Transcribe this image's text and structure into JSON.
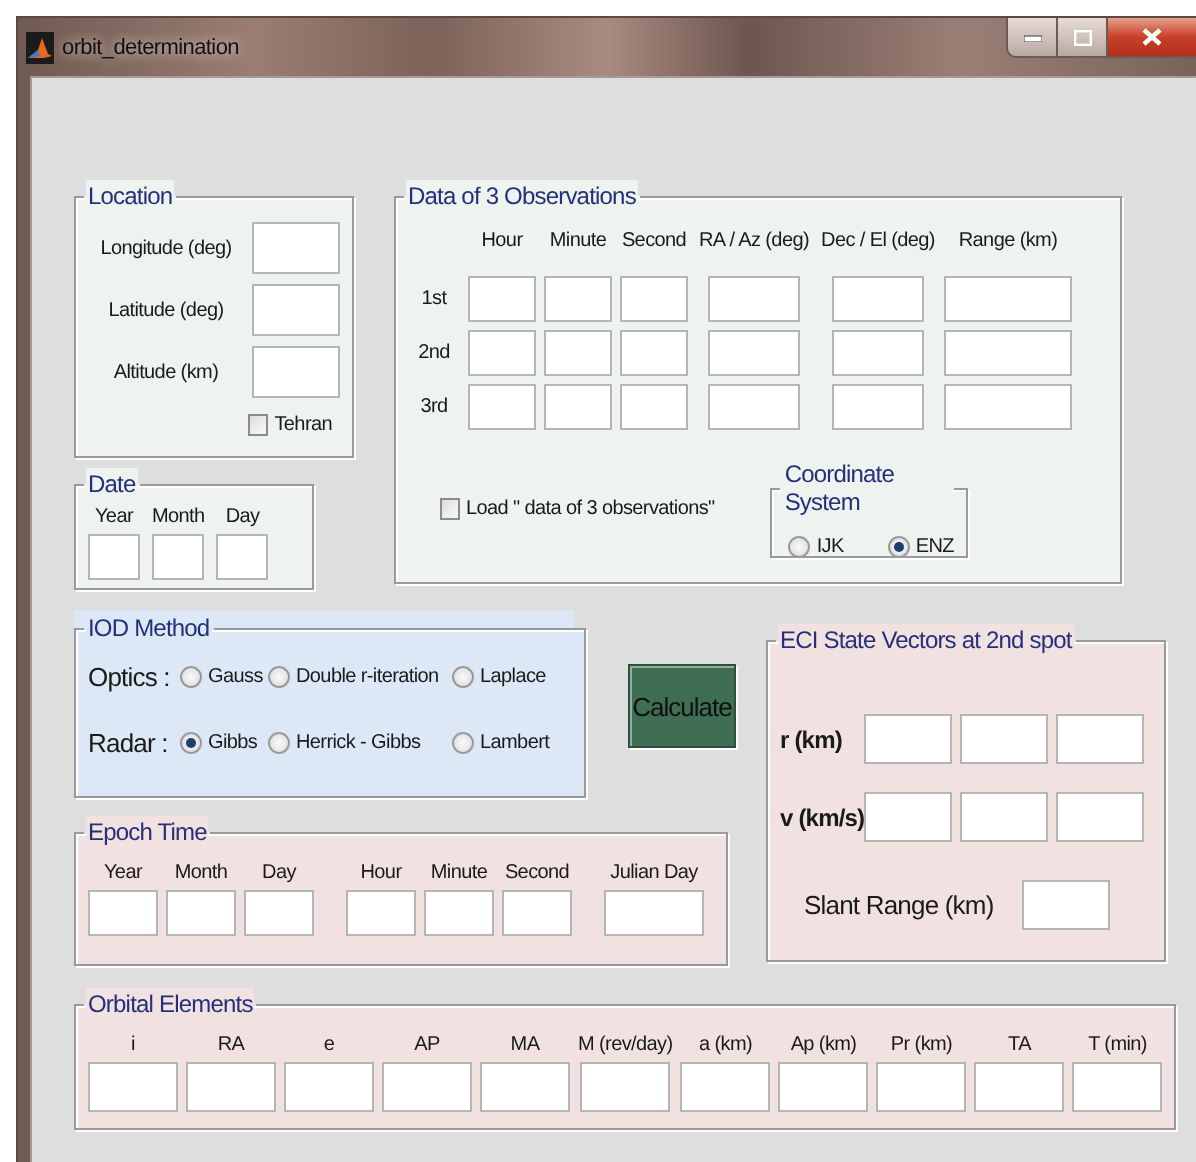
{
  "window": {
    "title": "orbit_determination"
  },
  "location": {
    "title": "Location",
    "fields": [
      "Longitude (deg)",
      "Latitude (deg)",
      "Altitude (km)"
    ],
    "tehran": {
      "label": "Tehran",
      "checked": false
    }
  },
  "date": {
    "title": "Date",
    "columns": [
      "Year",
      "Month",
      "Day"
    ]
  },
  "observations": {
    "title": "Data of 3 Observations",
    "columns": [
      "Hour",
      "Minute",
      "Second",
      "RA / Az (deg)",
      "Dec / El (deg)",
      "Range (km)"
    ],
    "rows": [
      "1st",
      "2nd",
      "3rd"
    ],
    "load": {
      "label": "Load \" data of 3 observations\"",
      "checked": false
    },
    "coordinate_system": {
      "title": "Coordinate System",
      "options": [
        {
          "label": "IJK",
          "selected": false
        },
        {
          "label": "ENZ",
          "selected": true
        }
      ]
    }
  },
  "iod_method": {
    "title": "IOD Method",
    "groups": [
      {
        "label": "Optics :",
        "options": [
          {
            "label": "Gauss",
            "selected": false
          },
          {
            "label": "Double r-iteration",
            "selected": false
          },
          {
            "label": "Laplace",
            "selected": false
          }
        ]
      },
      {
        "label": "Radar :",
        "options": [
          {
            "label": "Gibbs",
            "selected": true
          },
          {
            "label": "Herrick - Gibbs",
            "selected": false
          },
          {
            "label": "Lambert",
            "selected": false
          }
        ]
      }
    ]
  },
  "calculate_button": "Calculate",
  "epoch_time": {
    "title": "Epoch Time",
    "columns": [
      "Year",
      "Month",
      "Day",
      "Hour",
      "Minute",
      "Second",
      "Julian Day"
    ]
  },
  "eci_state_vectors": {
    "title": "ECI State Vectors at 2nd spot",
    "vectors": [
      "r (km)",
      "v (km/s)"
    ],
    "slant_range": "Slant Range (km)"
  },
  "orbital_elements": {
    "title": "Orbital Elements",
    "columns": [
      "i",
      "RA",
      "e",
      "AP",
      "MA",
      "M (rev/day)",
      "a (km)",
      "Ap (km)",
      "Pr (km)",
      "TA",
      "T (min)"
    ]
  }
}
